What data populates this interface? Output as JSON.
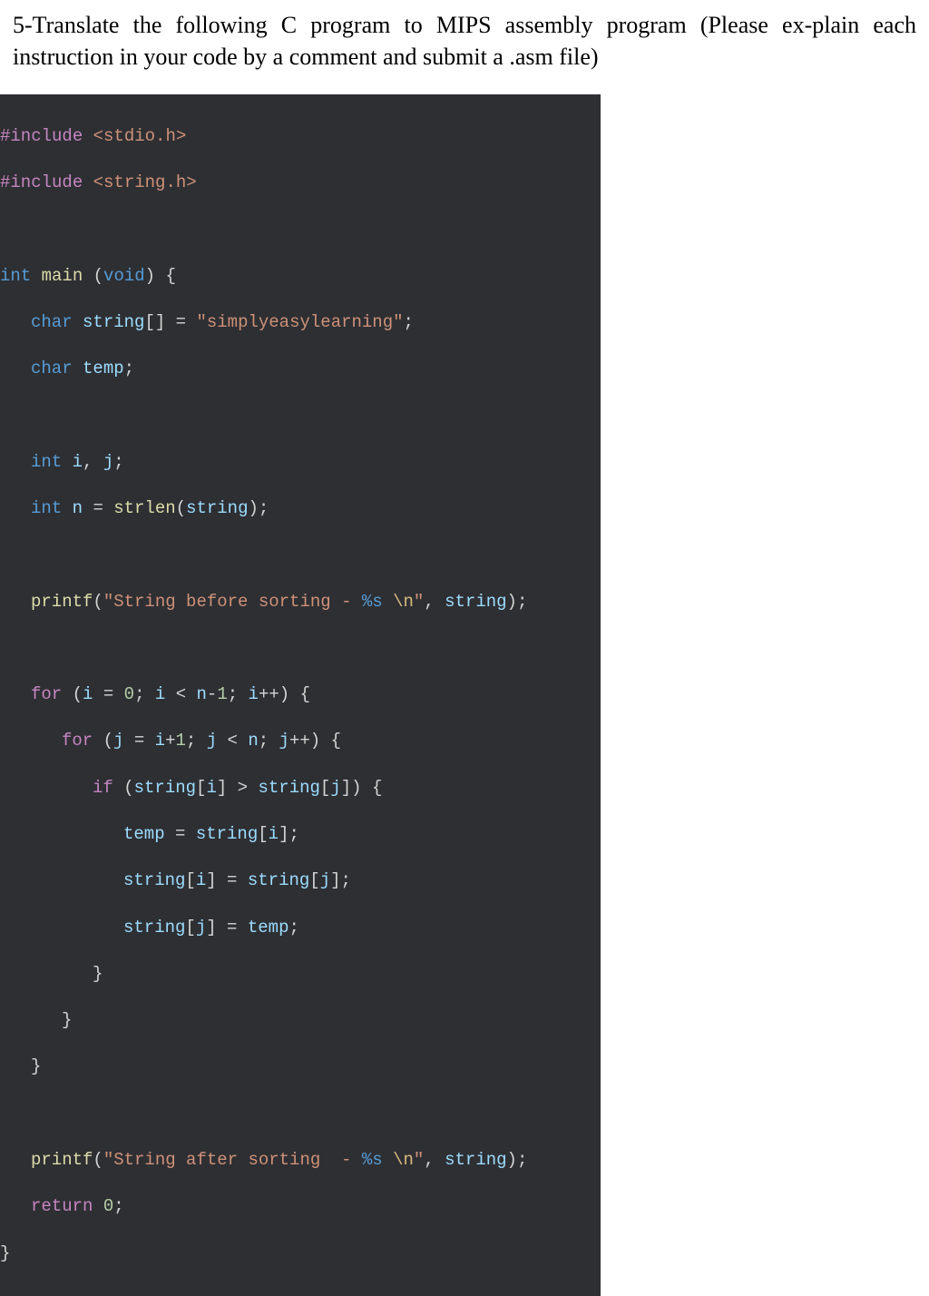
{
  "question": {
    "text": "5-Translate the following C program to MIPS assembly program (Please ex-plain each instruction in your code by a comment and submit a .asm file)"
  },
  "code": {
    "include1_a": "#include",
    "include1_b": "<stdio.h>",
    "include2_a": "#include",
    "include2_b": "<string.h>",
    "kw_int": "int",
    "kw_char": "char",
    "kw_void": "void",
    "kw_for": "for",
    "kw_if": "if",
    "kw_return": "return",
    "fn_main": "main",
    "fn_strlen": "strlen",
    "fn_printf": "printf",
    "id_string": "string",
    "id_temp": "temp",
    "id_i": "i",
    "id_j": "j",
    "id_n": "n",
    "num_0": "0",
    "num_1": "1",
    "str_init": "\"simplyeasylearning\"",
    "str_before_a": "\"String before sorting - ",
    "str_before_b": "%s",
    "str_before_c": " ",
    "str_after_a": "\"String after sorting  - ",
    "str_after_b": "%s",
    "str_after_c": " ",
    "esc_n": "\\n",
    "quote_close": "\"",
    "sym_lparen": "(",
    "sym_rparen": ")",
    "sym_lbrace": "{",
    "sym_rbrace": "}",
    "sym_lbrack": "[",
    "sym_rbrack": "]",
    "sym_empty_brackets": "[]",
    "sym_semicolon": ";",
    "sym_comma": ",",
    "sym_eq": "=",
    "sym_lt": "<",
    "sym_gt": ">",
    "sym_plus": "+",
    "sym_minus": "-",
    "sym_inc": "++",
    "sym_space": " "
  }
}
